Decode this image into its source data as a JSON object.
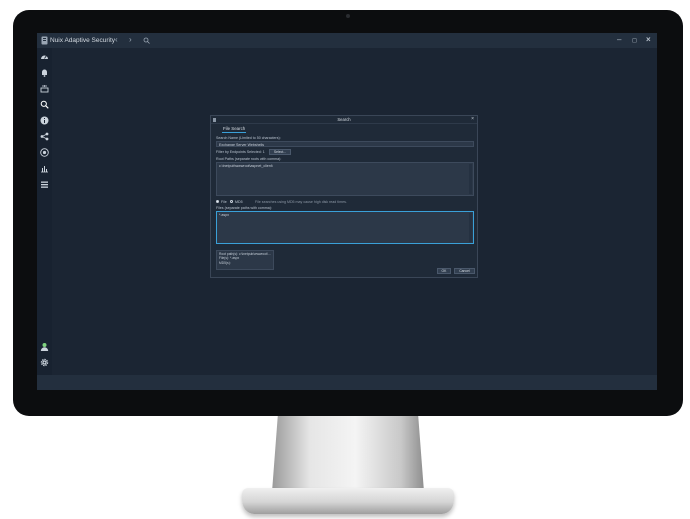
{
  "app": {
    "title": "Nuix Adaptive Security"
  },
  "dialog": {
    "title": "Search",
    "tab": "File Search",
    "search_name_label": "Search Name (Limited to 50 characters):",
    "search_name_value": "Exchange Server Webshells",
    "filter_label": "Filter by Endpoints Selected: 1",
    "select_button": "Select...",
    "root_paths_label": "Root Paths (separate roots with comma):",
    "root_paths_value": "c:\\inetpub\\wwwroot\\aspnet_client\\",
    "radio_file": "File",
    "radio_md5": "MD5",
    "md5_note": "File searches using MD5 may cause high disk read times.",
    "files_label": "Files (separate paths with comma):",
    "files_value": "*.aspx",
    "summary": {
      "root": "Root path(s): c:\\inetpub\\wwwroot\\...",
      "files": "File(s): *.aspx",
      "hash": "MD5(s):"
    },
    "ok_button": "OK",
    "cancel_button": "Cancel"
  },
  "colors": {
    "background": "#1b2533",
    "titlebar": "#232f3e",
    "accent": "#3aa0d8"
  },
  "icons": [
    "dashboard-icon",
    "bell-icon",
    "inbox-icon",
    "search-icon",
    "info-icon",
    "share-icon",
    "target-icon",
    "chart-icon",
    "list-icon",
    "user-icon",
    "gear-icon"
  ]
}
